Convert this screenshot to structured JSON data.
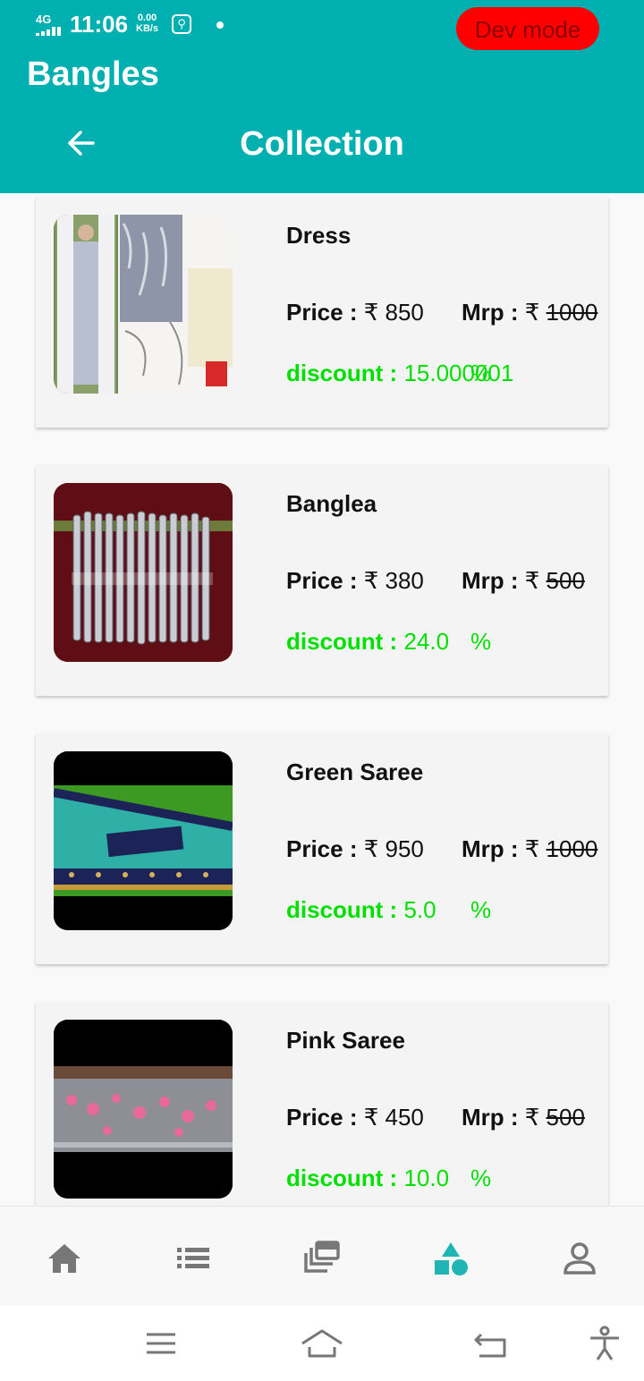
{
  "status_bar": {
    "network": "4G",
    "time": "11:06",
    "speed_value": "0.00",
    "speed_unit": "KB/s",
    "dev_mode_label": "Dev mode"
  },
  "header": {
    "app_title": "Bangles",
    "page_title": "Collection"
  },
  "products": [
    {
      "name": "Dress",
      "price_label": "Price : ",
      "price": "₹ 850",
      "mrp_label": "Mrp : ",
      "mrp_currency": "₹ ",
      "mrp": "1000",
      "discount_label": "discount : ",
      "discount": "15.000001",
      "percent": "%"
    },
    {
      "name": "Banglea",
      "price_label": "Price : ",
      "price": "₹ 380",
      "mrp_label": "Mrp : ",
      "mrp_currency": "₹ ",
      "mrp": "500",
      "discount_label": "discount : ",
      "discount": "24.0",
      "percent": "%"
    },
    {
      "name": "Green Saree",
      "price_label": "Price : ",
      "price": "₹ 950",
      "mrp_label": "Mrp : ",
      "mrp_currency": "₹ ",
      "mrp": "1000",
      "discount_label": "discount : ",
      "discount": "5.0",
      "percent": "%"
    },
    {
      "name": "Pink Saree",
      "price_label": "Price : ",
      "price": "₹ 450",
      "mrp_label": "Mrp : ",
      "mrp_currency": "₹ ",
      "mrp": "500",
      "discount_label": "discount : ",
      "discount": "10.0",
      "percent": "%"
    }
  ],
  "bottom_nav": {
    "items": [
      "home-icon",
      "list-icon",
      "collections-icon",
      "category-icon",
      "profile-icon"
    ],
    "active": "category-icon",
    "active_color": "#1fb5b5",
    "inactive_color": "#777777"
  },
  "colors": {
    "header": "#00afaf",
    "dev_mode": "#ff0000",
    "discount": "#00e000"
  }
}
